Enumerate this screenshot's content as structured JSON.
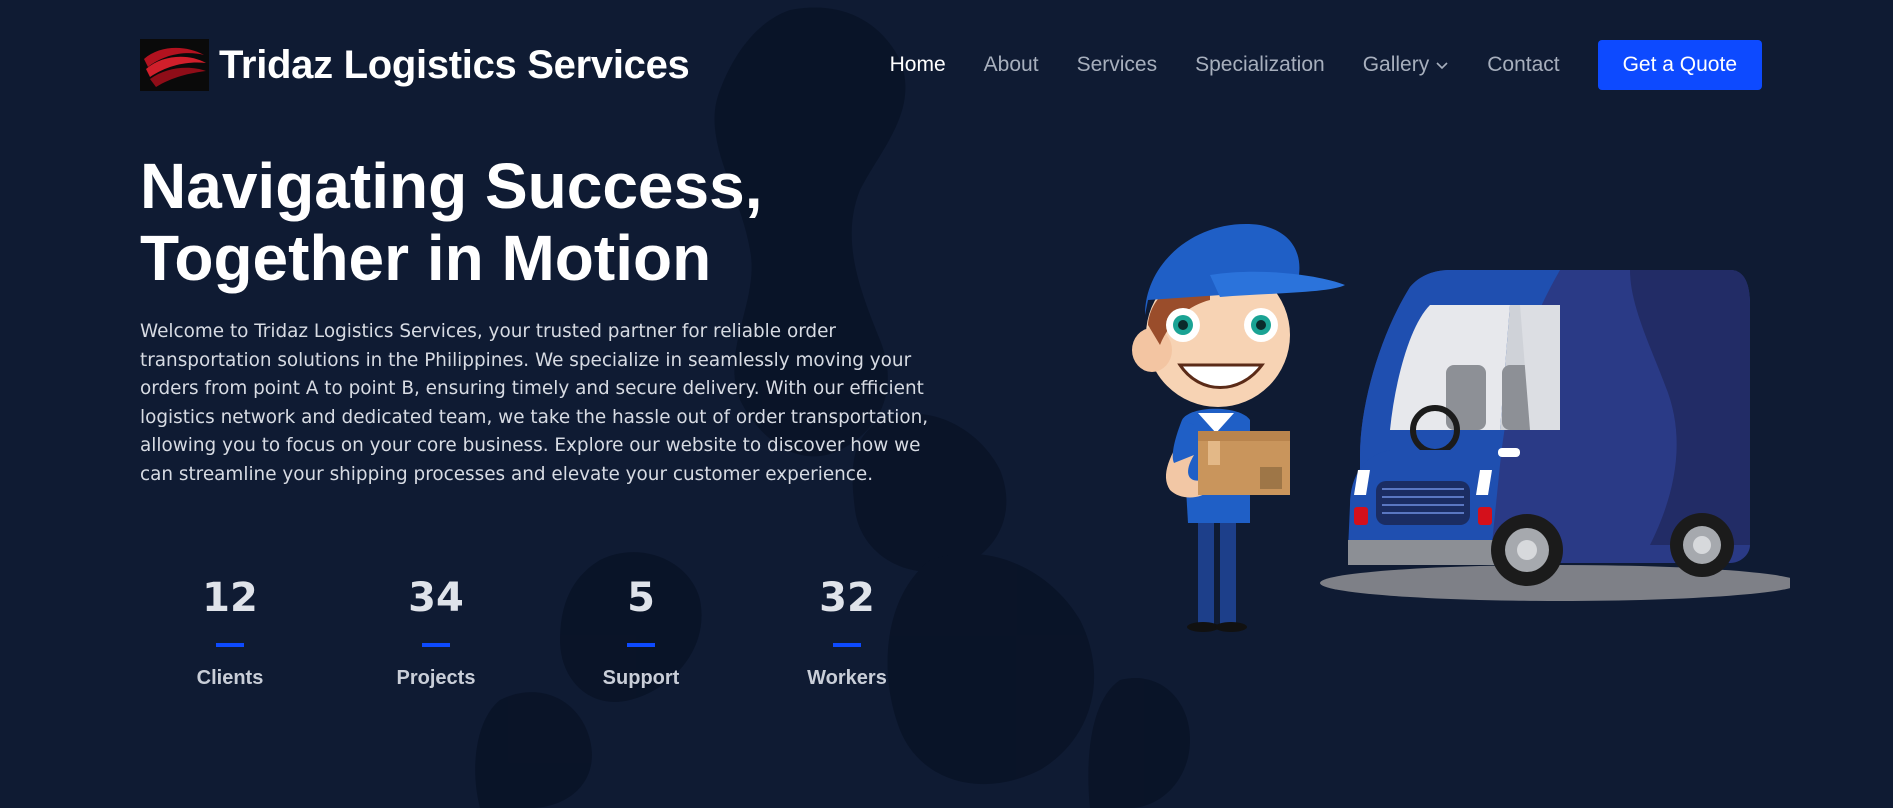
{
  "brand": {
    "name": "Tridaz Logistics Services",
    "logo_icon": "logo-swoosh-icon"
  },
  "nav": {
    "items": [
      {
        "label": "Home",
        "active": true
      },
      {
        "label": "About",
        "active": false
      },
      {
        "label": "Services",
        "active": false
      },
      {
        "label": "Specialization",
        "active": false
      },
      {
        "label": "Gallery",
        "active": false,
        "dropdown": true
      },
      {
        "label": "Contact",
        "active": false
      }
    ],
    "cta_label": "Get a Quote"
  },
  "hero": {
    "title_line1": "Navigating Success,",
    "title_line2": "Together in Motion",
    "description": "Welcome to Tridaz Logistics Services, your trusted partner for reliable order transportation solutions in the Philippines. We specialize in seamlessly moving your orders from point A to point B, ensuring timely and secure delivery. With our efficient logistics network and dedicated team, we take the hassle out of order transportation, allowing you to focus on your core business. Explore our website to discover how we can streamline your shipping processes and elevate your customer experience."
  },
  "stats": [
    {
      "value": "12",
      "label": "Clients"
    },
    {
      "value": "34",
      "label": "Projects"
    },
    {
      "value": "5",
      "label": "Support"
    },
    {
      "value": "32",
      "label": "Workers"
    }
  ],
  "colors": {
    "background": "#0f1b33",
    "accent": "#0d4aff",
    "text": "#ffffff",
    "muted": "#a7afbd"
  }
}
